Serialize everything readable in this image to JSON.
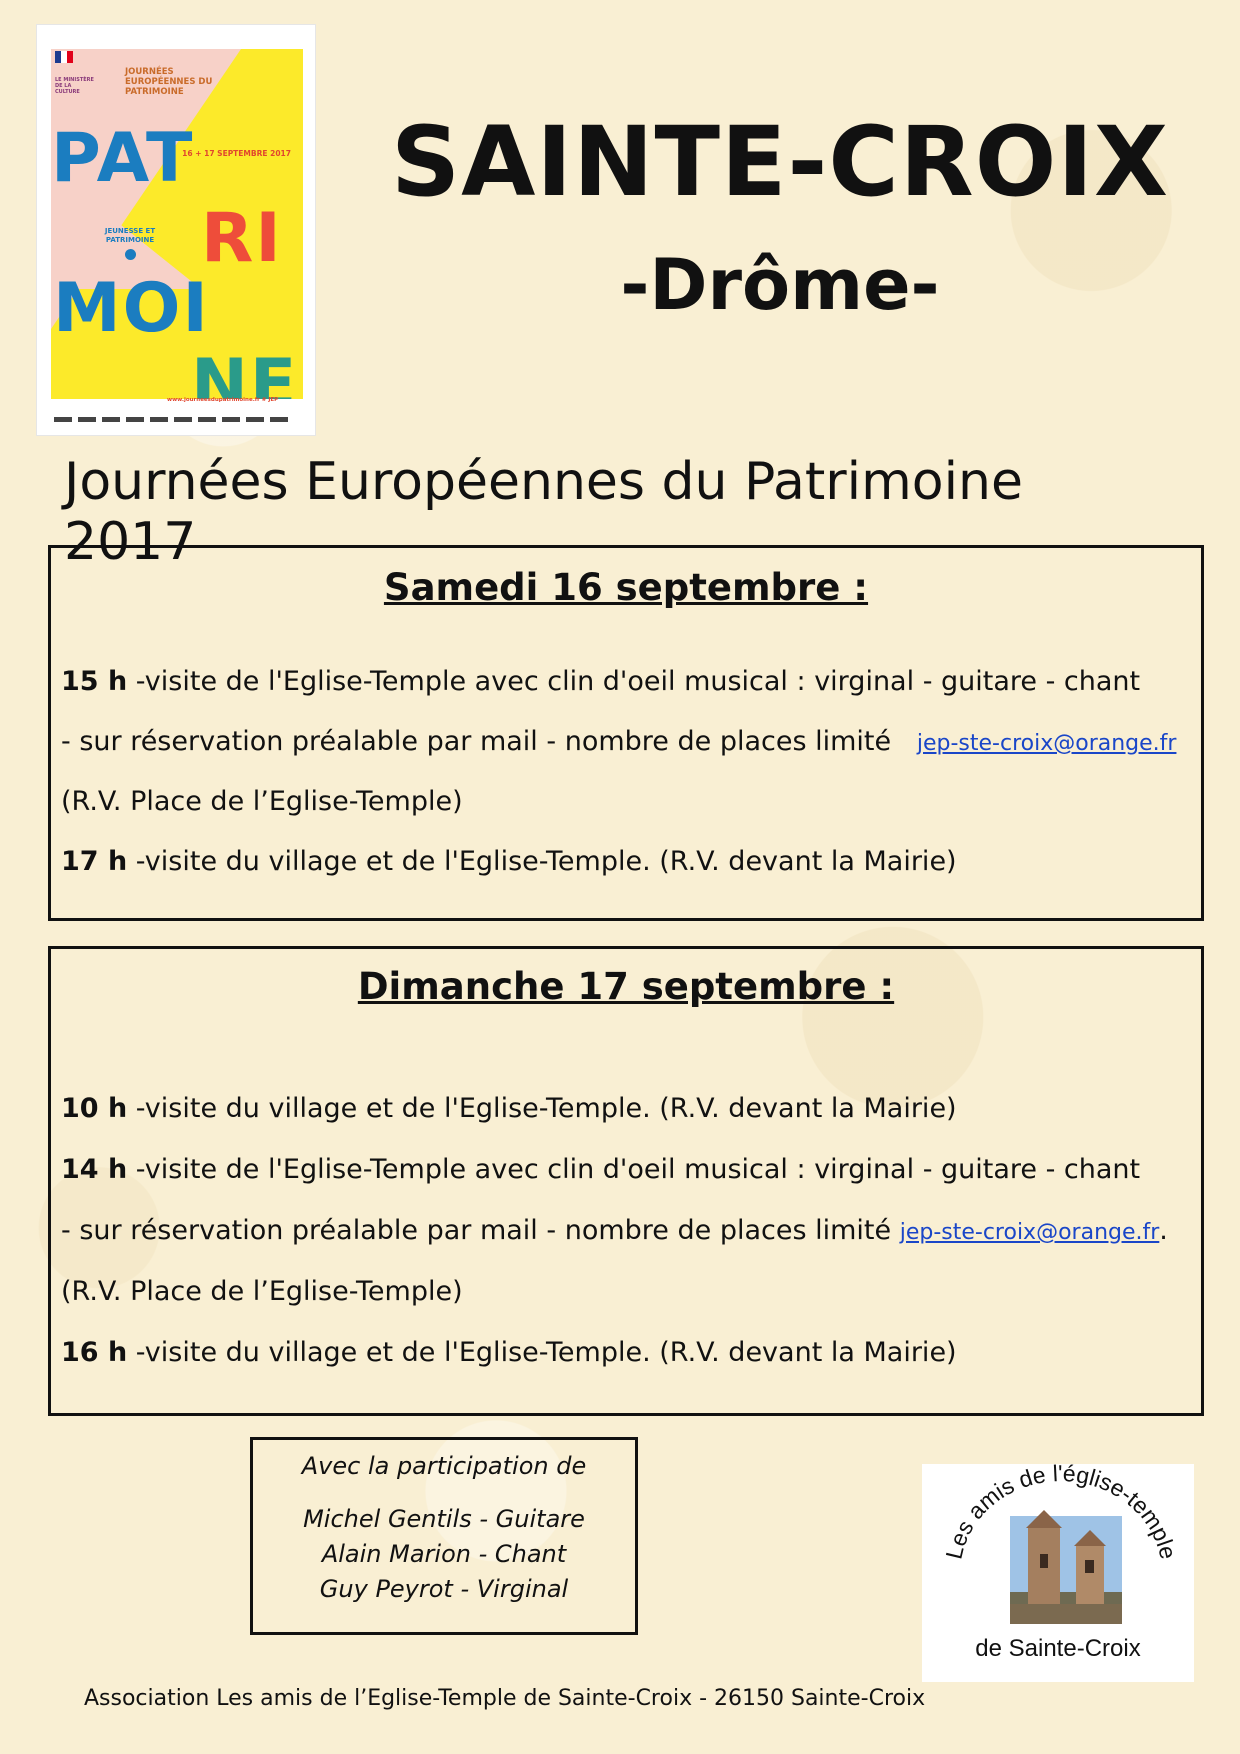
{
  "poster": {
    "ministere": "LE MINISTÈRE DE LA CULTURE",
    "header": "JOURNÉES EUROPÉENNES DU PATRIMOINE",
    "dates": "16 + 17 SEPTEMBRE 2017",
    "word_line1": "PAT",
    "word_line2": "RI",
    "word_line3": "MOI",
    "word_line4": "NE",
    "theme": "JEUNESSE ET PATRIMOINE",
    "url": "www.journeesdupatrimoine.fr  # JEP"
  },
  "title": "SAINTE-CROIX",
  "subtitle": "-Drôme-",
  "heading": "Journées Européennes du Patrimoine 2017",
  "saturday": {
    "title": "Samedi 16 septembre :",
    "lines": [
      {
        "time": "15 h",
        "text": " -visite de l'Eglise-Temple avec clin d'oeil musical : virginal - guitare - chant"
      },
      {
        "text": "- sur réservation préalable par mail - nombre de places limité",
        "email": "jep-ste-croix@orange.fr"
      },
      {
        "text": "(R.V. Place de l’Eglise-Temple)"
      },
      {
        "time": "17 h",
        "text": "  -visite du village et de l'Eglise-Temple. (R.V. devant la Mairie)"
      }
    ]
  },
  "sunday": {
    "title": "Dimanche 17 septembre :",
    "lines": [
      {
        "time": "10 h",
        "text": " -visite du village et de l'Eglise-Temple. (R.V. devant la Mairie)"
      },
      {
        "time": "14 h",
        "text": " -visite de l'Eglise-Temple avec clin d'oeil musical : virginal - guitare - chant"
      },
      {
        "text": "- sur réservation préalable par mail - nombre de places limité",
        "email": "jep-ste-croix@orange.fr",
        "suffix": "."
      },
      {
        "text": "(R.V. Place de l’Eglise-Temple)"
      },
      {
        "time": "16 h",
        "text": " -visite du village et de l'Eglise-Temple. (R.V. devant la Mairie)"
      }
    ]
  },
  "participation": {
    "intro": "Avec la participation de",
    "performers": [
      "Michel Gentils - Guitare",
      "Alain Marion - Chant",
      "Guy Peyrot - Virginal"
    ]
  },
  "logo": {
    "arc_text": "Les amis de l'église-temple",
    "bottom_text": "de Sainte-Croix"
  },
  "footer": "Association Les amis de l’Eglise-Temple de Sainte-Croix - 26150 Sainte-Croix"
}
